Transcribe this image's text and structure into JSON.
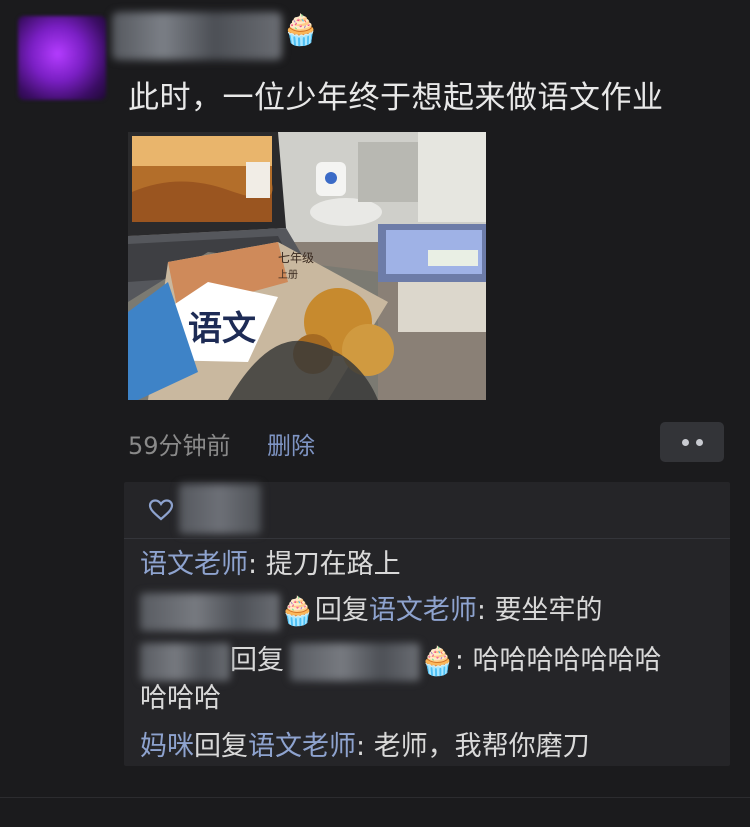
{
  "post": {
    "text": "此时，一位少年终于想起来做语文作业",
    "name_emoji": "🧁",
    "timestamp": "59分钟前",
    "delete_label": "删除",
    "photo_textbook_title": "语文",
    "photo_textbook_label": "七年级",
    "photo_textbook_sub": "上册"
  },
  "comments": [
    {
      "author": "语文老师",
      "separator": ": ",
      "text": "提刀在路上"
    },
    {
      "emoji": "🧁",
      "reply_word": "回复",
      "reply_to": "语文老师",
      "separator": ": ",
      "text": "要坐牢的"
    },
    {
      "reply_word": "回复",
      "emoji": "🧁",
      "separator": ": ",
      "text": "哈哈哈哈哈哈哈",
      "text_cont": "哈哈哈"
    },
    {
      "author": "妈咪",
      "reply_word": "回复",
      "reply_to": "语文老师",
      "separator": ": ",
      "text": "老师，我帮你磨刀"
    }
  ],
  "icons": [
    "heart-icon",
    "more-icon"
  ],
  "colors": {
    "background": "#1b1b1d",
    "name_link": "#8ea3cf",
    "comment_bg": "#252528",
    "timestamp": "#8a8a8a"
  }
}
